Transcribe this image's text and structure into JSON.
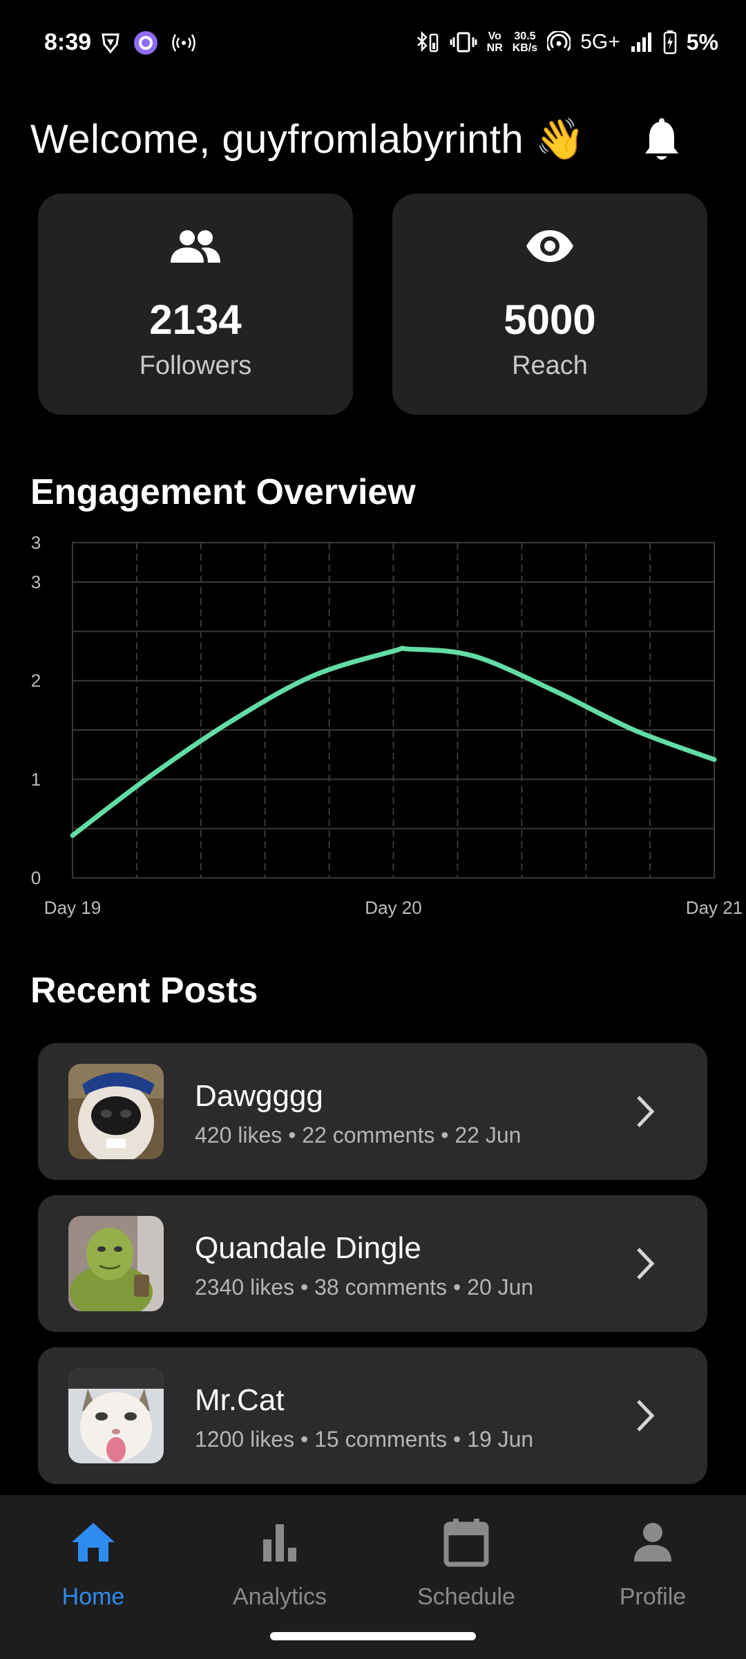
{
  "status_bar": {
    "time": "8:39",
    "net_speed_top": "30.5",
    "net_speed_bottom": "KB/s",
    "volte_top": "Vo",
    "volte_bottom": "NR",
    "network": "5G+",
    "battery": "5%",
    "icons": [
      "brave-icon",
      "app-icon",
      "hotspot-icon",
      "bluetooth-battery-icon",
      "vibrate-icon",
      "volte-icon",
      "wifi-calling-icon",
      "signal-icon",
      "battery-charging-icon"
    ]
  },
  "header": {
    "welcome": "Welcome, guyfromlabyrinth 👋",
    "notification_icon": "bell-icon"
  },
  "stats": [
    {
      "icon": "people-icon",
      "value": "2134",
      "label": "Followers"
    },
    {
      "icon": "eye-icon",
      "value": "5000",
      "label": "Reach"
    }
  ],
  "engagement": {
    "title": "Engagement Overview"
  },
  "chart_data": {
    "type": "line",
    "title": "",
    "xlabel": "",
    "ylabel": "",
    "x_ticks": [
      "Day 19",
      "Day 20",
      "Day 21"
    ],
    "y_ticks": [
      "3",
      "3",
      "2",
      "1",
      "0"
    ],
    "ylim": [
      0,
      3.4
    ],
    "grid": true,
    "series": [
      {
        "color": "#62dca5",
        "x": [
          19.0,
          19.25,
          19.5,
          19.75,
          20.0,
          20.05,
          20.25,
          20.5,
          20.75,
          21.0
        ],
        "y": [
          0.43,
          1.05,
          1.6,
          2.05,
          2.3,
          2.32,
          2.25,
          1.9,
          1.5,
          1.2
        ]
      }
    ],
    "colors": {
      "line": "#62dca5",
      "grid": "#3a3a3a",
      "tick": "#bdbdbd"
    }
  },
  "recent_posts": {
    "title": "Recent Posts",
    "items": [
      {
        "title": "Dawgggg",
        "meta": "420 likes • 22 comments • 22 Jun",
        "thumb": "dog-photo"
      },
      {
        "title": "Quandale Dingle",
        "meta": "2340 likes • 38 comments • 20 Jun",
        "thumb": "green-figure-photo"
      },
      {
        "title": "Mr.Cat",
        "meta": "1200 likes • 15 comments • 19 Jun",
        "thumb": "cat-photo"
      }
    ]
  },
  "nav": {
    "items": [
      {
        "label": "Home",
        "icon": "home-icon",
        "active": true
      },
      {
        "label": "Analytics",
        "icon": "bar-chart-icon",
        "active": false
      },
      {
        "label": "Schedule",
        "icon": "calendar-icon",
        "active": false
      },
      {
        "label": "Profile",
        "icon": "person-icon",
        "active": false
      }
    ],
    "active_color": "#2e8cf0",
    "inactive_color": "#8a8a8a"
  }
}
